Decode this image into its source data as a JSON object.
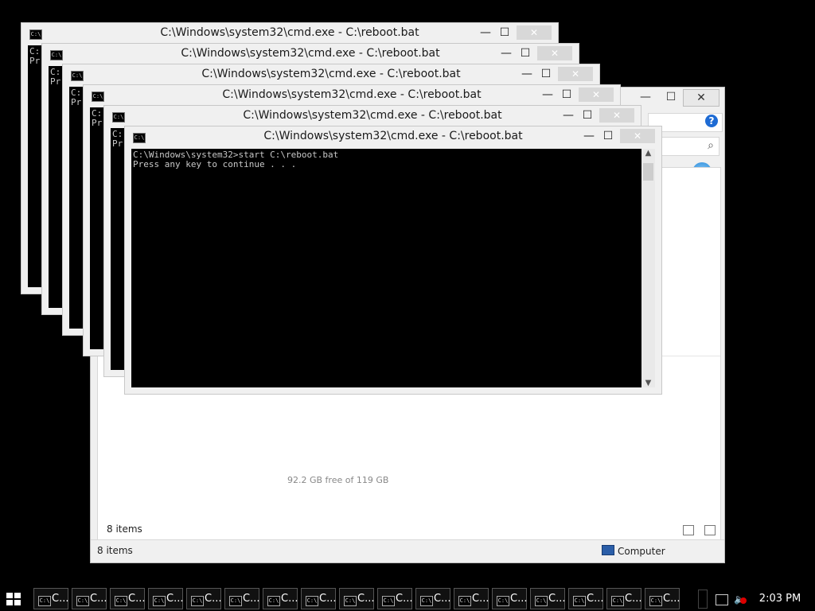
{
  "explorer": {
    "help_label": "?",
    "search_icon": "search-icon",
    "items_count_content": "8 items",
    "items_count_status": "8 items",
    "status_location": "Computer",
    "drive_free_text": "92.2 GB free of 119 GB"
  },
  "cmd": {
    "title": "C:\\Windows\\system32\\cmd.exe - C:\\reboot.bat",
    "icon_label": "C:\\",
    "min_glyph": "—",
    "max_glyph": "☐",
    "close_glyph": "✕",
    "stack_visible_prefix": "C:\nPr",
    "front_console": "C:\\Windows\\system32>start C:\\reboot.bat\nPress any key to continue . . ."
  },
  "taskbar": {
    "item_label": "C...",
    "item_icon": "C:\\",
    "clock": "2:03 PM"
  }
}
